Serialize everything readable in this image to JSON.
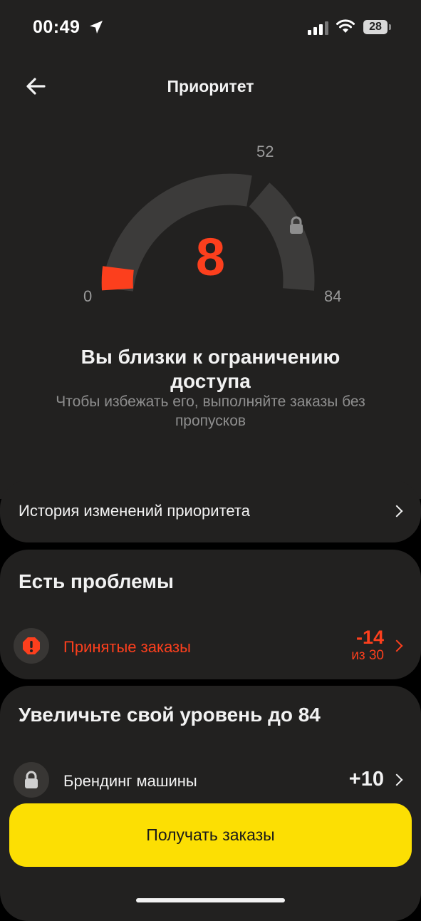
{
  "status_bar": {
    "time": "00:49",
    "battery": "28"
  },
  "header": {
    "title": "Приоритет"
  },
  "gauge": {
    "value": "8",
    "min": "0",
    "mid": "52",
    "max": "84"
  },
  "message": {
    "headline": "Вы близки к ограничению доступа",
    "subline": "Чтобы избежать его, выполняйте заказы без пропусков"
  },
  "history": {
    "label": "История изменений приоритета"
  },
  "problems": {
    "title": "Есть проблемы",
    "items": [
      {
        "label": "Принятые заказы",
        "value": "-14",
        "sub": "из 30"
      }
    ]
  },
  "upgrade": {
    "title": "Увеличьте свой уровень до 84",
    "items": [
      {
        "label": "Брендинг машины",
        "value": "+10"
      }
    ]
  },
  "cta": {
    "label": "Получать заказы"
  },
  "colors": {
    "accent_red": "#fc3f1d",
    "accent_yellow": "#fcdf03",
    "card_bg": "#222120"
  }
}
